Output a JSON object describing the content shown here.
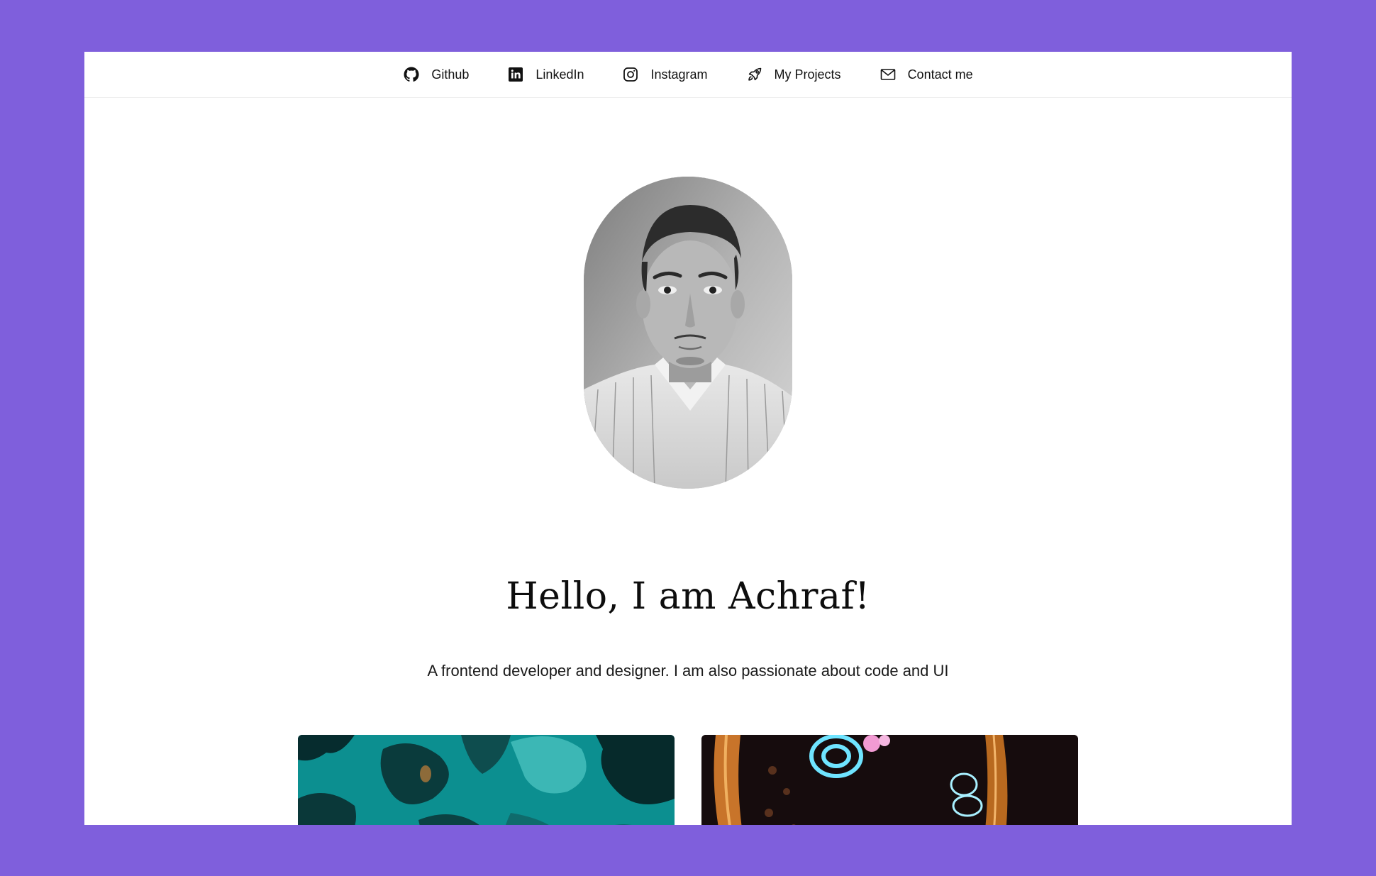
{
  "nav": {
    "items": [
      {
        "label": "Github",
        "icon": "github-icon"
      },
      {
        "label": "LinkedIn",
        "icon": "linkedin-icon"
      },
      {
        "label": "Instagram",
        "icon": "instagram-icon"
      },
      {
        "label": "My Projects",
        "icon": "rocket-icon"
      },
      {
        "label": "Contact me",
        "icon": "mail-icon"
      }
    ]
  },
  "hero": {
    "title": "Hello, I am Achraf!",
    "subtitle": "A frontend developer and designer. I am also passionate about code and UI"
  },
  "colors": {
    "background": "#7f5fdc",
    "page": "#ffffff",
    "text": "#111111"
  }
}
